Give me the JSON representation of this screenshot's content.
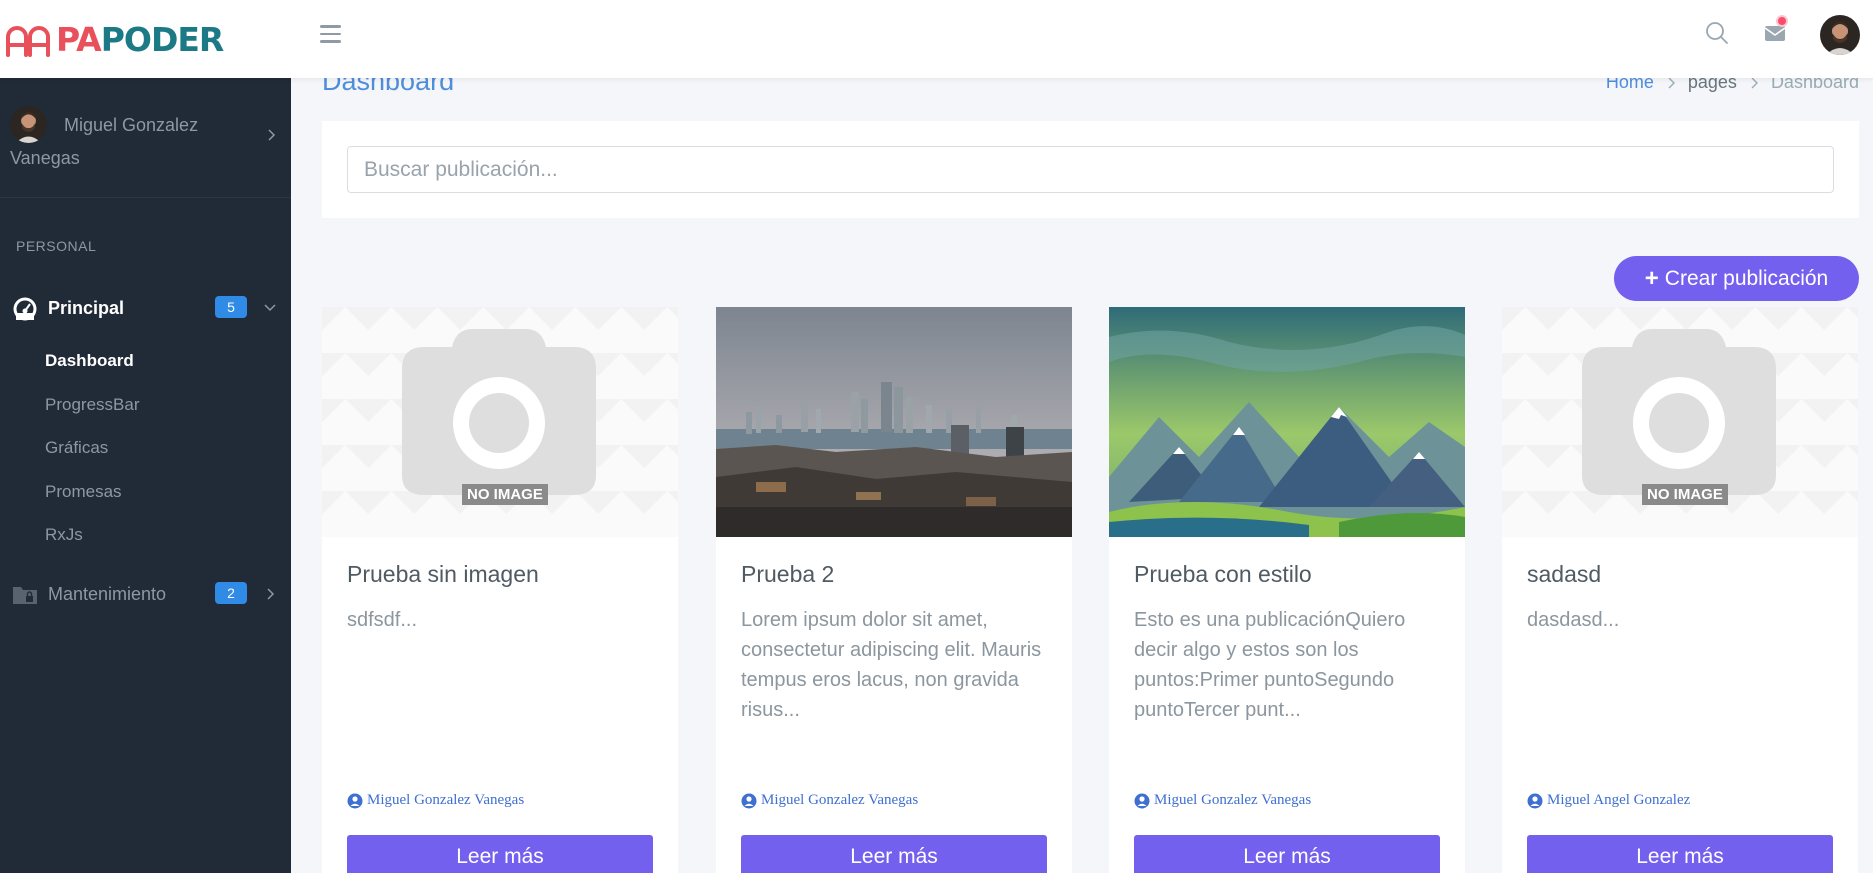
{
  "brand": {
    "name_part1": "PA",
    "name_part2": "PODER",
    "accent": "#e8505b",
    "secondary": "#1b7a86"
  },
  "topbar": {
    "menu_icon": "hamburger-icon",
    "search_icon": "search-icon",
    "mail_icon": "mail-icon",
    "avatar": "user-avatar"
  },
  "sidebar": {
    "user_name": "Miguel Gonzalez Vanegas",
    "section_caption": "PERSONAL",
    "groups": [
      {
        "label": "Principal",
        "badge": "5",
        "icon": "gauge-icon",
        "expanded": true,
        "items": [
          "Dashboard",
          "ProgressBar",
          "Gráficas",
          "Promesas",
          "RxJs"
        ],
        "active_item": "Dashboard"
      },
      {
        "label": "Mantenimiento",
        "badge": "2",
        "icon": "folder-lock-icon",
        "expanded": false
      }
    ]
  },
  "page": {
    "title": "Dashboard",
    "breadcrumb": [
      "Home",
      "pages",
      "Dashboard"
    ]
  },
  "search": {
    "placeholder": "Buscar publicación...",
    "value": ""
  },
  "create_button": {
    "label": "Crear publicación",
    "icon": "plus-icon"
  },
  "posts": [
    {
      "title": "Prueba sin imagen",
      "excerpt": "sdfsdf...",
      "author": "Miguel Gonzalez Vanegas",
      "image": "no-image-placeholder",
      "no_image_label": "NO IMAGE",
      "button": "Leer más"
    },
    {
      "title": "Prueba 2",
      "excerpt": "Lorem ipsum dolor sit amet, consectetur adipiscing elit. Mauris tempus eros lacus, non gravida risus...",
      "author": "Miguel Gonzalez Vanegas",
      "image": "city-skyline-photo",
      "button": "Leer más"
    },
    {
      "title": "Prueba con estilo",
      "excerpt": "Esto es una publicaciónQuiero decir algo y estos son los puntos:Primer puntoSegundo puntoTercer punt...",
      "author": "Miguel Gonzalez Vanegas",
      "image": "mountains-illustration",
      "button": "Leer más"
    },
    {
      "title": "sadasd",
      "excerpt": "dasdasd...",
      "author": "Miguel Angel Gonzalez",
      "image": "no-image-placeholder",
      "no_image_label": "NO IMAGE",
      "button": "Leer más"
    }
  ],
  "colors": {
    "primary": "#7460ee",
    "sidebar_bg": "#212a37",
    "badge": "#2f8be6",
    "link": "#4e8edb",
    "notification": "#fc4b6c"
  }
}
